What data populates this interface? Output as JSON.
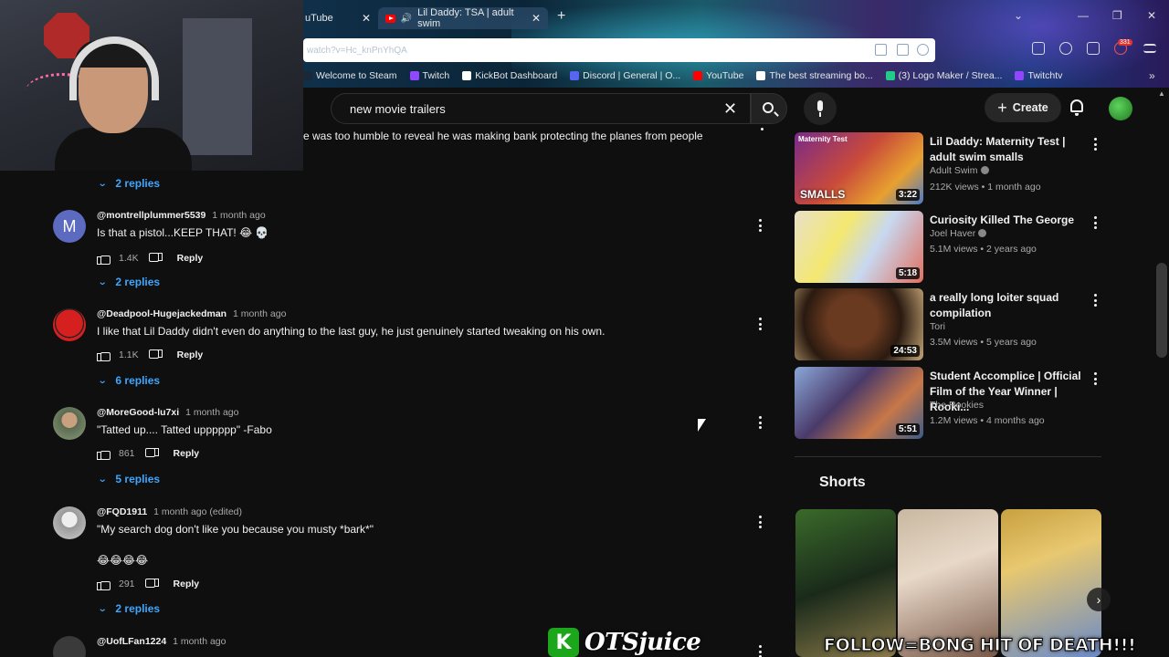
{
  "browser": {
    "tabs": [
      {
        "label": "uTube"
      },
      {
        "label": "Lil Daddy: TSA | adult swim"
      }
    ],
    "new_tab": "+",
    "address": "watch?v=Hc_knPnYhQA",
    "badge": "331",
    "bookmarks": [
      {
        "label": "Welcome to Steam",
        "color": "#1b2838"
      },
      {
        "label": "Twitch",
        "color": "#9146ff"
      },
      {
        "label": "KickBot Dashboard",
        "color": "#ffffff"
      },
      {
        "label": "Discord | General | O...",
        "color": "#5865f2"
      },
      {
        "label": "YouTube",
        "color": "#ff0000"
      },
      {
        "label": "The best streaming bo...",
        "color": "#ffffff"
      },
      {
        "label": "(3) Logo Maker / Strea...",
        "color": "#22cc88"
      },
      {
        "label": "Twitchtv",
        "color": "#9146ff"
      }
    ]
  },
  "masthead": {
    "search_query": "new movie trailers",
    "create_label": "Create"
  },
  "partial_comment_text": "e was too humble to reveal he was making bank protecting the planes from people",
  "comments": [
    {
      "author": "@montrellplummer5539",
      "time": "1 month ago",
      "text": "Is that a pistol...KEEP THAT! 😂 💀",
      "likes": "1.4K",
      "reply_label": "Reply",
      "avatar_letter": "M",
      "avatar_color": "#5c6bc0"
    },
    {
      "author": "@Deadpool-Hugejackedman",
      "time": "1 month ago",
      "text": "I like that Lil Daddy didn't even do anything to the last guy, he just genuinely started tweaking on his own.",
      "likes": "1.1K",
      "reply_label": "Reply"
    },
    {
      "author": "@MoreGood-lu7xi",
      "time": "1 month ago",
      "text": "\"Tatted up.... Tatted upppppp\" -Fabo",
      "likes": "861",
      "reply_label": "Reply"
    },
    {
      "author": "@FQD1911",
      "time": "1 month ago (edited)",
      "text": "\"My search dog don't like you because you musty *bark*\"",
      "text2": "😂😂😂😂",
      "likes": "291",
      "reply_label": "Reply"
    },
    {
      "author": "@UofLFan1224",
      "time": "1 month ago"
    }
  ],
  "reply_toggles": [
    "2 replies",
    "2 replies",
    "6 replies",
    "5 replies",
    "2 replies"
  ],
  "related": [
    {
      "title": "Lil Daddy: Maternity Test | adult swim smalls",
      "channel": "Adult Swim",
      "verified": true,
      "stats": "212K views • 1 month ago",
      "duration": "3:22",
      "thumb_label": "SMALLS",
      "thumb_top": "Maternity Test"
    },
    {
      "title": "Curiosity Killed The George",
      "channel": "Joel Haver",
      "verified": true,
      "stats": "5.1M views • 2 years ago",
      "duration": "5:18"
    },
    {
      "title": "a really long loiter squad compilation",
      "channel": "Tori",
      "verified": false,
      "stats": "3.5M views • 5 years ago",
      "duration": "24:53"
    },
    {
      "title": "Student Accomplice | Official Film of the Year Winner | Rooki...",
      "channel": "The Rookies",
      "verified": false,
      "stats": "1.2M views • 4 months ago",
      "duration": "5:51"
    }
  ],
  "shorts": {
    "title": "Shorts"
  },
  "overlay": {
    "watermark_letter": "K",
    "watermark_text": "OTSjuice",
    "follow_text": "FOLLOW=BONG HIT OF DEATH!!!"
  },
  "colors": {
    "accent_link": "#3ea6ff",
    "background": "#0f0f0f",
    "watermark_green": "#1ba61b"
  }
}
